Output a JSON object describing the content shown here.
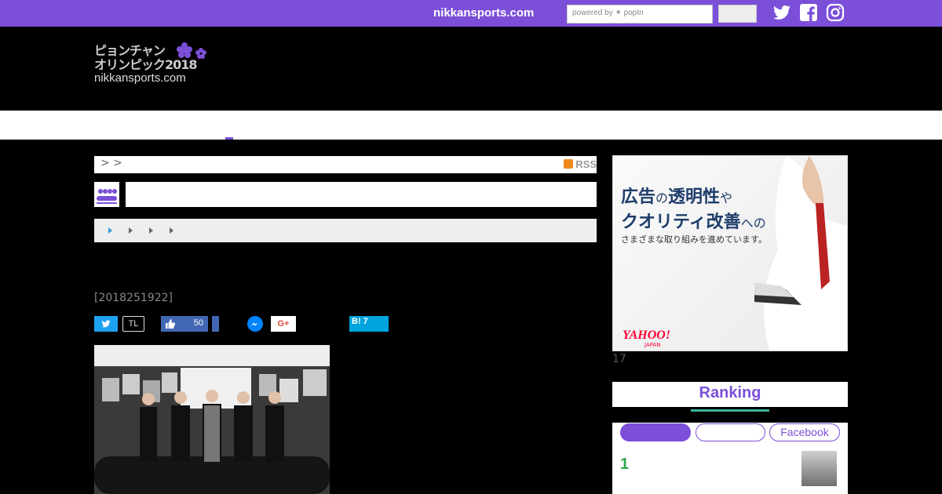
{
  "topbar": {
    "site_name": "nikkansports.com",
    "search_placeholder": "powered by ✶ popIn",
    "brand_color": "#7b4fd8",
    "social_icons": [
      "twitter-icon",
      "facebook-icon",
      "instagram-icon"
    ]
  },
  "header": {
    "logo_line1": "ピョンチャン",
    "logo_line2": "オリンピック2018",
    "logo_line3": "nikkansports.com"
  },
  "breadcrumb": {
    "text": "> >",
    "rss_label": "RSS"
  },
  "article": {
    "date": "[2018251922]"
  },
  "share": {
    "timeline_label": "TL",
    "like_count": "50",
    "gplus_label": "G+",
    "hatena_label": "B! 7"
  },
  "ad": {
    "line1_strong": "広告",
    "line1_small": "の",
    "line1_strong2": "透明性",
    "line1_small2": "や",
    "line2_strong": "クオリティ改善",
    "line2_small": "への",
    "line3": "さまざまな取り組みを進めています。",
    "logo": "YAHOO!",
    "logo_sub": "JAPAN",
    "count": "17"
  },
  "ranking": {
    "title": "Ranking",
    "tabs": [
      "",
      "",
      "Facebook"
    ],
    "first_rank": "1",
    "accent_color": "#3bb3a0",
    "rank_color": "#2ea84a"
  }
}
